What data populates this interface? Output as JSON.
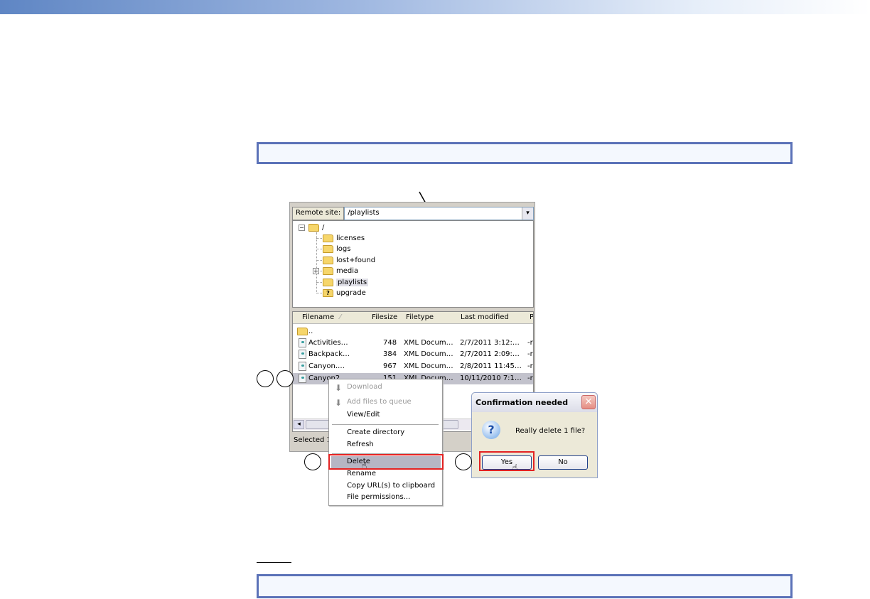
{
  "remote_site": {
    "label": "Remote site:",
    "value": "/playlists"
  },
  "tree": {
    "root": "/",
    "items": [
      "licenses",
      "logs",
      "lost+found",
      "media",
      "playlists",
      "upgrade"
    ]
  },
  "list": {
    "columns": [
      "Filename",
      "Filesize",
      "Filetype",
      "Last modified",
      "P"
    ],
    "parent": "..",
    "rows": [
      {
        "name": "Activities…",
        "size": "748",
        "type": "XML Docum…",
        "modified": "2/7/2011 3:12:…",
        "perm": "-r"
      },
      {
        "name": "Backpack…",
        "size": "384",
        "type": "XML Docum…",
        "modified": "2/7/2011 2:09:…",
        "perm": "-r"
      },
      {
        "name": "Canyon.…",
        "size": "967",
        "type": "XML Docum…",
        "modified": "2/8/2011 11:45…",
        "perm": "-r"
      },
      {
        "name": "Canyon2…",
        "size": "151",
        "type": "XML Docum…",
        "modified": "10/11/2010 7:1…",
        "perm": "-r"
      }
    ],
    "status": "Selected 1"
  },
  "menu": {
    "items": [
      "Download",
      "Add files to queue",
      "View/Edit",
      "Create directory",
      "Refresh",
      "Delete",
      "Rename",
      "Copy URL(s) to clipboard",
      "File permissions..."
    ]
  },
  "dialog": {
    "title": "Confirmation needed",
    "message": "Really delete 1 file?",
    "yes": "Yes",
    "no": "No"
  }
}
